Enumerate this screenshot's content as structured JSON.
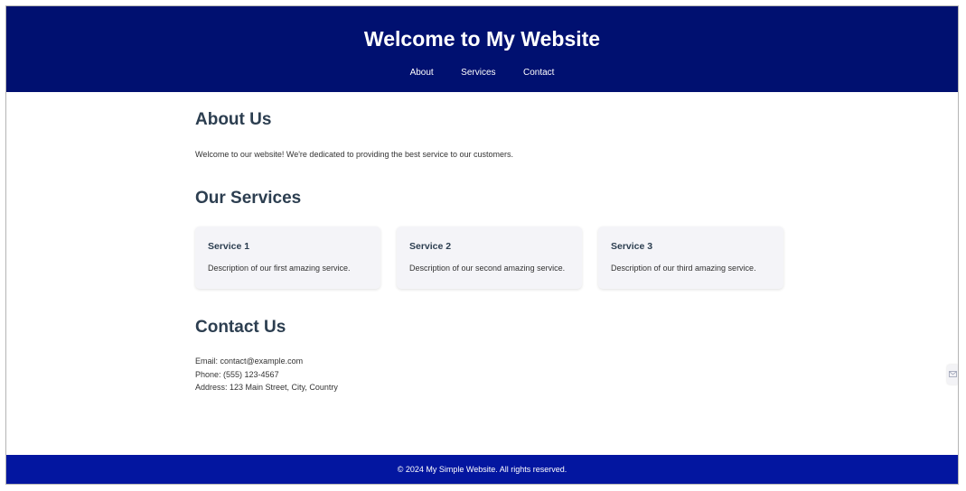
{
  "header": {
    "title": "Welcome to My Website",
    "nav": [
      {
        "label": "About"
      },
      {
        "label": "Services"
      },
      {
        "label": "Contact"
      }
    ]
  },
  "about": {
    "title": "About Us",
    "text": "Welcome to our website! We're dedicated to providing the best service to our customers."
  },
  "services": {
    "title": "Our Services",
    "items": [
      {
        "title": "Service 1",
        "description": "Description of our first amazing service."
      },
      {
        "title": "Service 2",
        "description": "Description of our second amazing service."
      },
      {
        "title": "Service 3",
        "description": "Description of our third amazing service."
      }
    ]
  },
  "contact": {
    "title": "Contact Us",
    "email": "Email: contact@example.com",
    "phone": "Phone: (555) 123-4567",
    "address": "Address: 123 Main Street, City, Country"
  },
  "footer": {
    "text": "© 2024 My Simple Website. All rights reserved."
  },
  "side_widget": {
    "icon": "mail-icon"
  },
  "colors": {
    "header_bg": "#001070",
    "footer_bg": "#0316a0",
    "heading": "#2c3e50",
    "card_bg": "#f4f4f8"
  }
}
